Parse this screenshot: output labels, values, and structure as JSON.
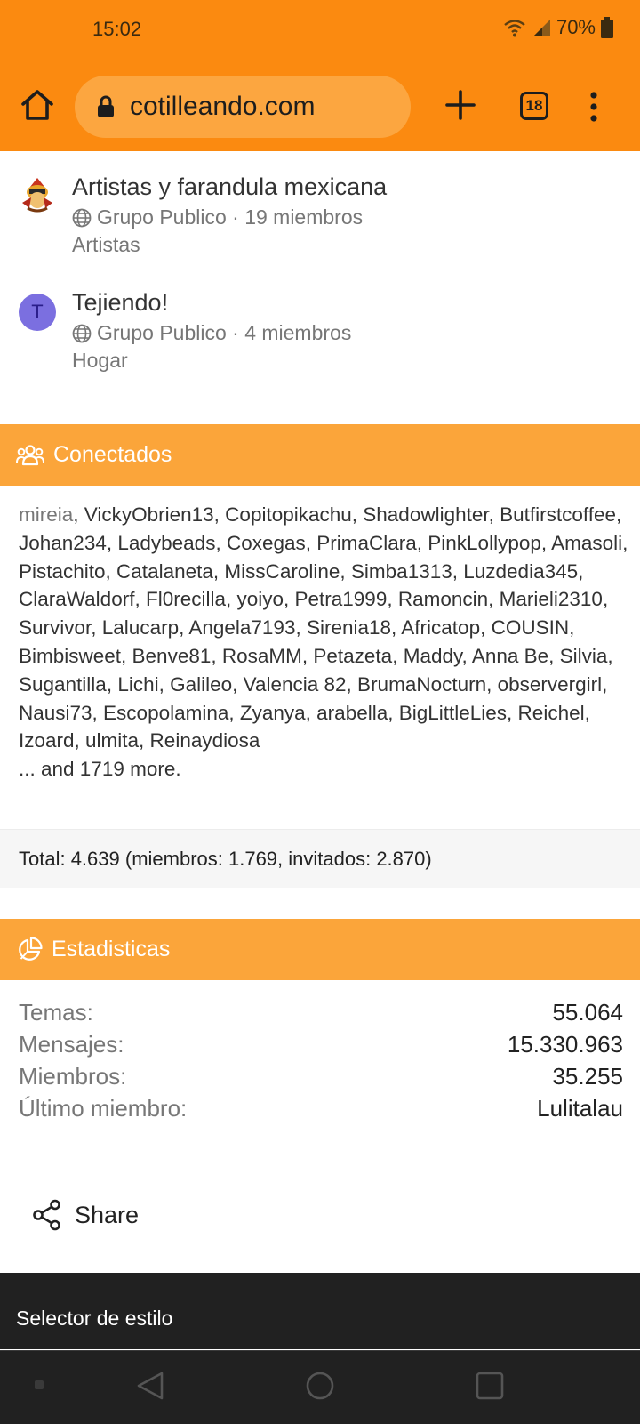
{
  "status_bar": {
    "time": "15:02",
    "battery": "70%"
  },
  "browser": {
    "url": "cotilleando.com",
    "tab_count": "18"
  },
  "groups": [
    {
      "title": "Artistas y farandula mexicana",
      "meta": "Grupo Publico · 19 miembros",
      "category": "Artistas",
      "avatar_letter": ""
    },
    {
      "title": "Tejiendo!",
      "meta": "Grupo Publico · 4 miembros",
      "category": "Hogar",
      "avatar_letter": "T"
    }
  ],
  "online": {
    "heading": "Conectados",
    "first_user": "mireia",
    "users_rest": ", VickyObrien13, Copitopikachu, Shadowlighter, Butfirstcoffee, Johan234, Ladybeads, Coxegas, PrimaClara, PinkLollypop, Amasoli, Pistachito, Catalaneta, MissCaroline, Simba1313, Luzdedia345, ClaraWaldorf, Fl0recilla, yoiyo, Petra1999, Ramoncin, Marieli2310, Survivor, Lalucarp, Angela7193, Sirenia18, Africatop, COUSIN, Bimbisweet, Benve81, RosaMM, Petazeta, Maddy, Anna Be, Silvia, Sugantilla, Lichi, Galileo, Valencia 82, BrumaNocturn, observergirl, Nausi73, Escopolamina, Zyanya, arabella, BigLittleLies, Reichel, Izoard, ulmita, Reinaydiosa",
    "more": "... and 1719 more.",
    "total": "Total: 4.639 (miembros: 1.769, invitados: 2.870)"
  },
  "stats": {
    "heading": "Estadisticas",
    "rows": [
      {
        "label": "Temas:",
        "value": "55.064"
      },
      {
        "label": "Mensajes:",
        "value": "15.330.963"
      },
      {
        "label": "Miembros:",
        "value": "35.255"
      },
      {
        "label": "Último miembro:",
        "value": "Lulitalau"
      }
    ]
  },
  "share_label": "Share",
  "footer": {
    "style_selector": "Selector de estilo"
  },
  "colors": {
    "chrome": "#fb8a10",
    "section_header": "#fba53a",
    "avatar_purple": "#7b6fe0"
  }
}
